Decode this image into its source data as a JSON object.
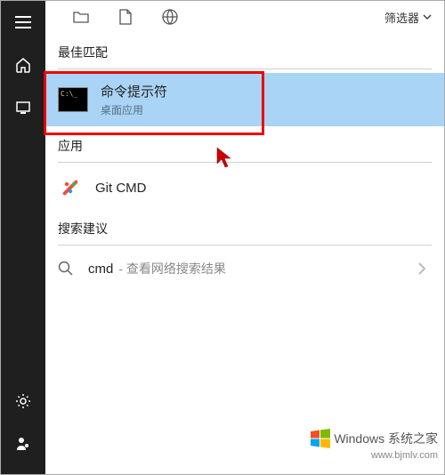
{
  "filter": {
    "label": "筛选器"
  },
  "sections": {
    "best_match": "最佳匹配",
    "apps": "应用",
    "suggestions": "搜索建议"
  },
  "results": {
    "cmd": {
      "title": "命令提示符",
      "subtitle": "桌面应用"
    },
    "git": {
      "title": "Git CMD"
    }
  },
  "suggestion": {
    "query": "cmd",
    "hint": "查看网络搜索结果"
  },
  "watermark": {
    "brand": "Windows 系统之家",
    "url": "www.bjmlv.com"
  }
}
